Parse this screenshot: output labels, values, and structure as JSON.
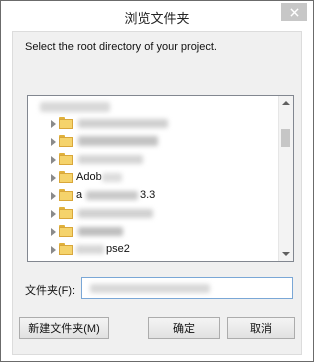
{
  "window": {
    "title": "浏览文件夹"
  },
  "prompt": "Select the root directory of your project.",
  "tree": {
    "items": [
      {
        "label": "",
        "obscured": true,
        "has_expander": false
      },
      {
        "label": "",
        "obscured": true,
        "has_expander": true
      },
      {
        "label": "",
        "obscured": true,
        "has_expander": true
      },
      {
        "label": "",
        "obscured": true,
        "has_expander": true
      },
      {
        "label": "Adob",
        "obscured": true,
        "has_expander": true
      },
      {
        "label": "a",
        "label_suffix": "3.3",
        "obscured": true,
        "has_expander": true
      },
      {
        "label": "",
        "obscured": true,
        "has_expander": true
      },
      {
        "label": "",
        "obscured": true,
        "has_expander": true
      },
      {
        "label": "pse2",
        "obscured": true,
        "has_expander": true
      }
    ]
  },
  "folder_field": {
    "label": "文件夹(F):",
    "value": ""
  },
  "buttons": {
    "new_folder": "新建文件夹(M)",
    "ok": "确定",
    "cancel": "取消"
  },
  "colors": {
    "folder_fill": "#f5d36b",
    "folder_border": "#d9a73a",
    "input_border": "#7aa7d6"
  }
}
